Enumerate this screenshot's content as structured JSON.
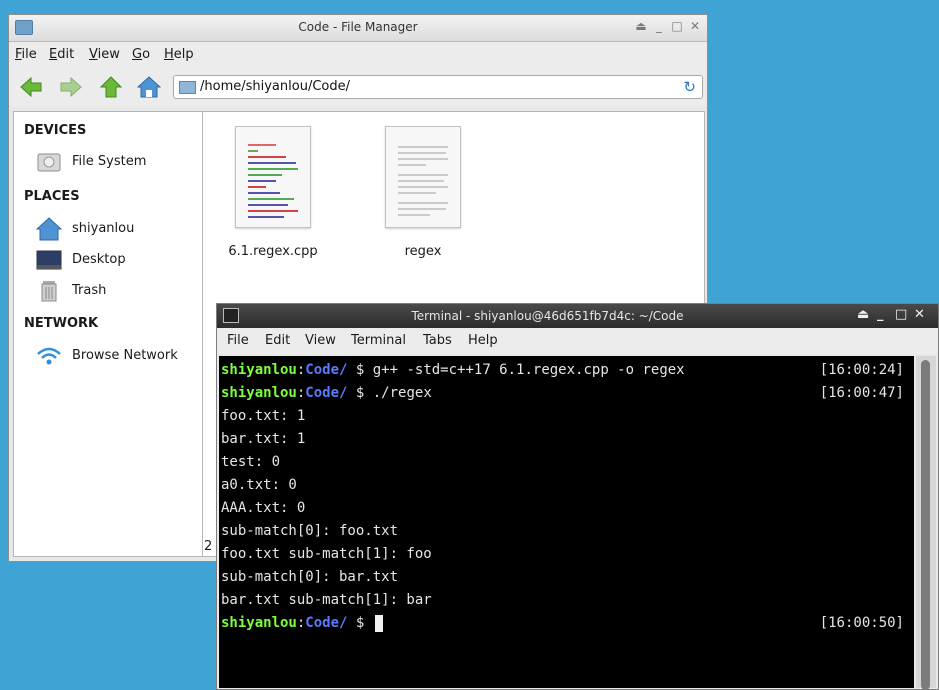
{
  "file_manager": {
    "title": "Code - File Manager",
    "menu": [
      "File",
      "Edit",
      "View",
      "Go",
      "Help"
    ],
    "address": "/home/shiyanlou/Code/",
    "sidebar": {
      "devices_header": "DEVICES",
      "places_header": "PLACES",
      "network_header": "NETWORK",
      "items": [
        {
          "label": "File System",
          "icon": "drive-icon"
        },
        {
          "label": "shiyanlou",
          "icon": "home-folder-icon"
        },
        {
          "label": "Desktop",
          "icon": "desktop-icon"
        },
        {
          "label": "Trash",
          "icon": "trash-icon"
        },
        {
          "label": "Browse Network",
          "icon": "wifi-icon"
        }
      ]
    },
    "files": [
      {
        "name": "6.1.regex.cpp",
        "icon": "source-file-icon"
      },
      {
        "name": "regex",
        "icon": "text-file-icon"
      }
    ],
    "status_fragment": "2"
  },
  "terminal": {
    "title": "Terminal - shiyanlou@46d651fb7d4c: ~/Code",
    "menu": [
      "File",
      "Edit",
      "View",
      "Terminal",
      "Tabs",
      "Help"
    ],
    "prompt_user": "shiyanlou",
    "prompt_colon": ":",
    "prompt_dir": "Code/",
    "prompt_symbol": " $ ",
    "commands": [
      {
        "cmd": "g++ -std=c++17 6.1.regex.cpp -o regex",
        "time": "[16:00:24]"
      },
      {
        "cmd": "./regex",
        "time": "[16:00:47]"
      }
    ],
    "output": [
      "foo.txt: 1",
      "bar.txt: 1",
      "test: 0",
      "a0.txt: 0",
      "AAA.txt: 0",
      "sub-match[0]: foo.txt",
      "foo.txt sub-match[1]: foo",
      "sub-match[0]: bar.txt",
      "bar.txt sub-match[1]: bar"
    ],
    "last_time": "[16:00:50]"
  }
}
